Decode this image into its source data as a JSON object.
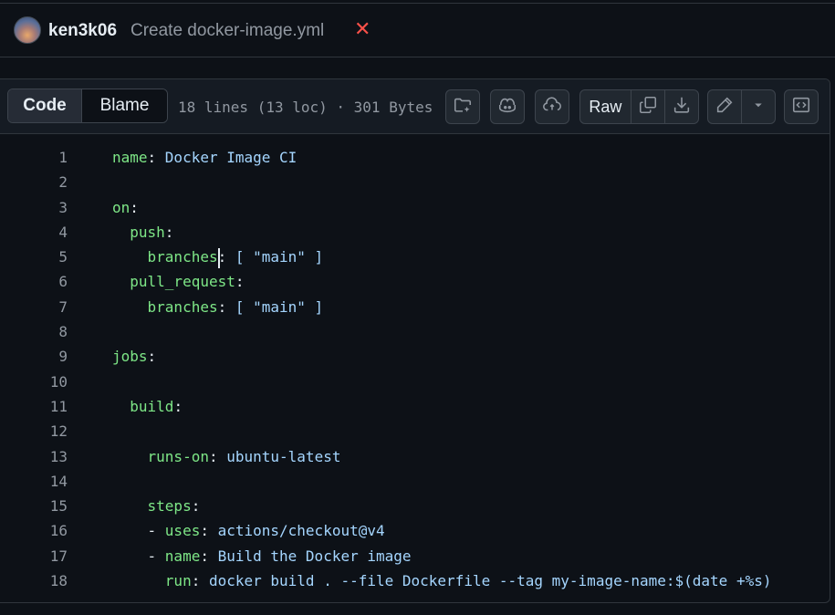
{
  "commit": {
    "author": "ken3k06",
    "message": "Create docker-image.yml",
    "status_icon": "x-mark-icon",
    "status_color": "#f85149"
  },
  "file": {
    "tabs": [
      {
        "label": "Code",
        "active": true
      },
      {
        "label": "Blame",
        "active": false
      }
    ],
    "info": "18 lines (13 loc) · 301 Bytes",
    "raw_label": "Raw",
    "toolbar_icons": [
      "folder-sparkle-icon",
      "copilot-icon",
      "cloud-sync-icon",
      "copy-icon",
      "download-icon",
      "pencil-icon",
      "chevron-down-icon",
      "code-square-icon"
    ]
  },
  "code": {
    "lines": [
      {
        "n": "1",
        "indent": "",
        "key": "name",
        "sep": ": ",
        "val": "Docker Image CI"
      },
      {
        "n": "2",
        "indent": "",
        "key": "",
        "sep": "",
        "val": ""
      },
      {
        "n": "3",
        "indent": "",
        "key": "on",
        "sep": ":",
        "val": ""
      },
      {
        "n": "4",
        "indent": "  ",
        "key": "push",
        "sep": ":",
        "val": ""
      },
      {
        "n": "5",
        "indent": "    ",
        "key": "branches",
        "sep": ": ",
        "val": "[ \"main\" ]"
      },
      {
        "n": "6",
        "indent": "  ",
        "key": "pull_request",
        "sep": ":",
        "val": ""
      },
      {
        "n": "7",
        "indent": "    ",
        "key": "branches",
        "sep": ": ",
        "val": "[ \"main\" ]"
      },
      {
        "n": "8",
        "indent": "",
        "key": "",
        "sep": "",
        "val": ""
      },
      {
        "n": "9",
        "indent": "",
        "key": "jobs",
        "sep": ":",
        "val": ""
      },
      {
        "n": "10",
        "indent": "",
        "key": "",
        "sep": "",
        "val": ""
      },
      {
        "n": "11",
        "indent": "  ",
        "key": "build",
        "sep": ":",
        "val": ""
      },
      {
        "n": "12",
        "indent": "",
        "key": "",
        "sep": "",
        "val": ""
      },
      {
        "n": "13",
        "indent": "    ",
        "key": "runs-on",
        "sep": ": ",
        "val": "ubuntu-latest"
      },
      {
        "n": "14",
        "indent": "",
        "key": "",
        "sep": "",
        "val": ""
      },
      {
        "n": "15",
        "indent": "    ",
        "key": "steps",
        "sep": ":",
        "val": ""
      },
      {
        "n": "16",
        "indent": "    - ",
        "key": "uses",
        "sep": ": ",
        "val": "actions/checkout@v4"
      },
      {
        "n": "17",
        "indent": "    - ",
        "key": "name",
        "sep": ": ",
        "val": "Build the Docker image"
      },
      {
        "n": "18",
        "indent": "      ",
        "key": "run",
        "sep": ": ",
        "val": "docker build . --file Dockerfile --tag my-image-name:$(date +%s)"
      }
    ]
  }
}
